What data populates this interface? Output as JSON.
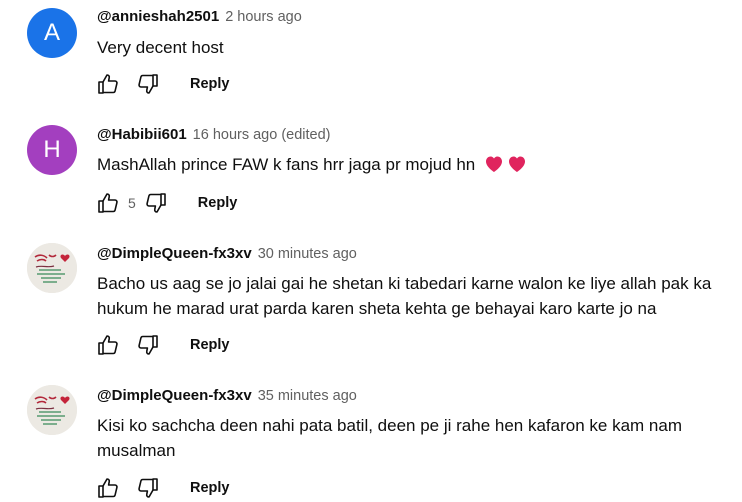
{
  "comments": [
    {
      "avatar_letter": "A",
      "avatar_color": "#1a73e8",
      "author": "@annieshah2501",
      "time": "2 hours ago",
      "edited": "",
      "text": "Very decent host",
      "likes": "",
      "reply_label": "Reply"
    },
    {
      "avatar_letter": "H",
      "avatar_color": "#a33fbf",
      "author": "@Habibii601",
      "time": "16 hours ago",
      "edited": "(edited)",
      "text": "MashAllah prince FAW k fans hrr jaga pr mojud hn",
      "emoji": [
        "red-heart-icon",
        "red-heart-icon"
      ],
      "likes": "5",
      "reply_label": "Reply"
    },
    {
      "avatar_letter": "",
      "avatar_color": "#e9e6e0",
      "author": "@DimpleQueen-fx3xv",
      "time": "30 minutes ago",
      "edited": "",
      "text": "Bacho us aag se jo jalai gai he shetan ki tabedari karne walon ke liye  allah pak ka hukum he marad urat parda karen sheta kehta ge behayai karo  karte jo na",
      "likes": "",
      "reply_label": "Reply"
    },
    {
      "avatar_letter": "",
      "avatar_color": "#e9e6e0",
      "author": "@DimpleQueen-fx3xv",
      "time": "35 minutes ago",
      "edited": "",
      "text": "Kisi ko sachcha deen nahi pata batil, deen pe ji rahe hen  kafaron ke kam nam musalman",
      "likes": "",
      "reply_label": "Reply"
    }
  ],
  "colors": {
    "text_primary": "#0f0f0f",
    "text_secondary": "#606060",
    "heart": "#e0245e"
  }
}
